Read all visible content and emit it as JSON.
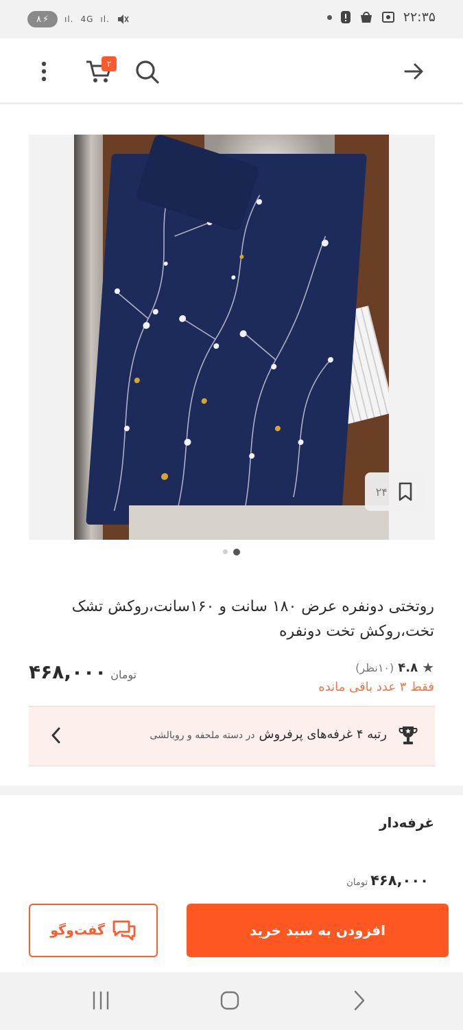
{
  "status_bar": {
    "battery": "۸",
    "network": "4G",
    "time": "۲۲:۳۵"
  },
  "top_bar": {
    "cart_count": "۲",
    "icons": [
      "more-vertical-icon",
      "cart-icon",
      "search-icon",
      "arrow-right-icon"
    ]
  },
  "gallery": {
    "save_count": "۲۴",
    "page_total": 2,
    "page_active": 2
  },
  "product": {
    "title": "روتختی دونفره عرض ۱۸۰ سانت و ۱۶۰سانت،روکش تشک تخت،روکش تخت دونفره",
    "rating": "۴.۸",
    "rating_count": "(۱۰نظر)",
    "stock_note": "فقط ۳ عدد باقی مانده",
    "price": "۴۶۸,۰۰۰",
    "currency": "تومان"
  },
  "rank": {
    "main": "رتبه ۴ غرفه‌های پرفروش",
    "sub": "در دسته ملحفه و روبالشی"
  },
  "seller": {
    "label": "غرفه‌دار",
    "price": "۴۶۸,۰۰۰",
    "currency": "تومان"
  },
  "actions": {
    "add_to_cart": "افزودن به سبد خرید",
    "chat": "گفت‌وگو"
  },
  "colors": {
    "accent": "#ff5722",
    "rank_bg": "#fdf0ec",
    "stock_text": "#f0744a"
  }
}
